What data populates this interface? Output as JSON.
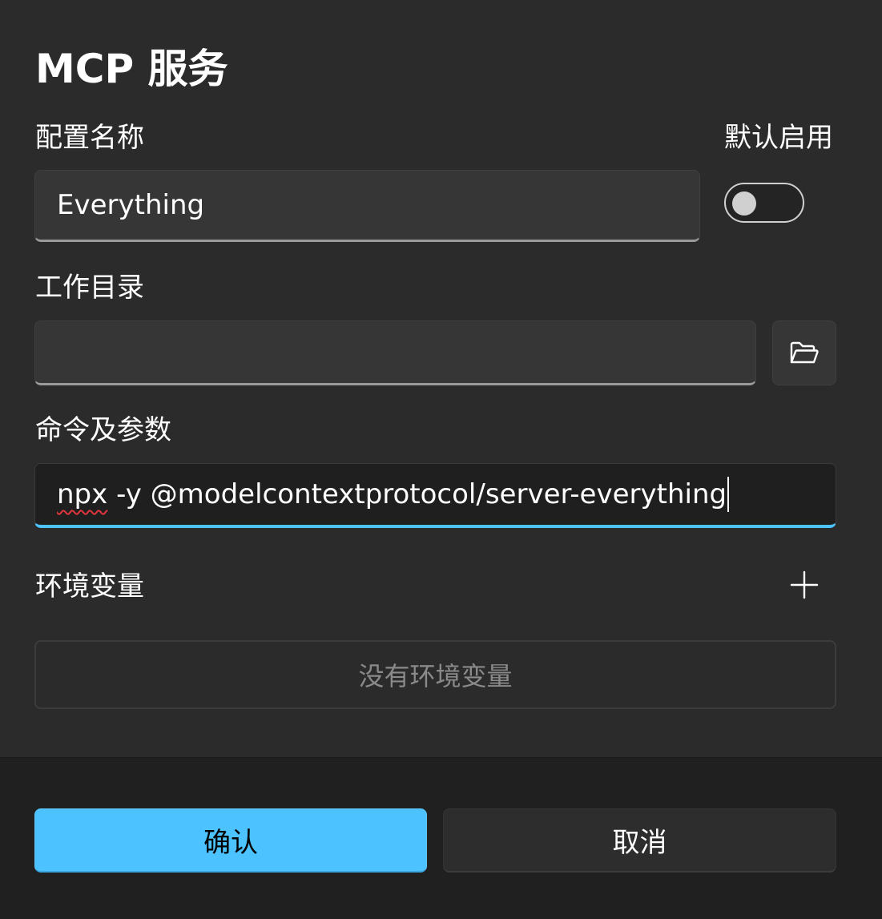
{
  "dialog": {
    "title": "MCP 服务"
  },
  "form": {
    "config_name_label": "配置名称",
    "config_name_value": "Everything",
    "default_enable_label": "默认启用",
    "default_enable_on": false,
    "workdir_label": "工作目录",
    "workdir_value": "",
    "command_label": "命令及参数",
    "command_value_part1": "npx",
    "command_value_part2": " -y @modelcontextprotocol/server-everything",
    "env_label": "环境变量",
    "env_empty_text": "没有环境变量"
  },
  "icons": {
    "folder": "folder-open-icon",
    "add": "plus-icon"
  },
  "footer": {
    "confirm_label": "确认",
    "cancel_label": "取消"
  },
  "colors": {
    "accent": "#4cc2ff",
    "background": "#2b2b2b",
    "footer_background": "#202020"
  }
}
